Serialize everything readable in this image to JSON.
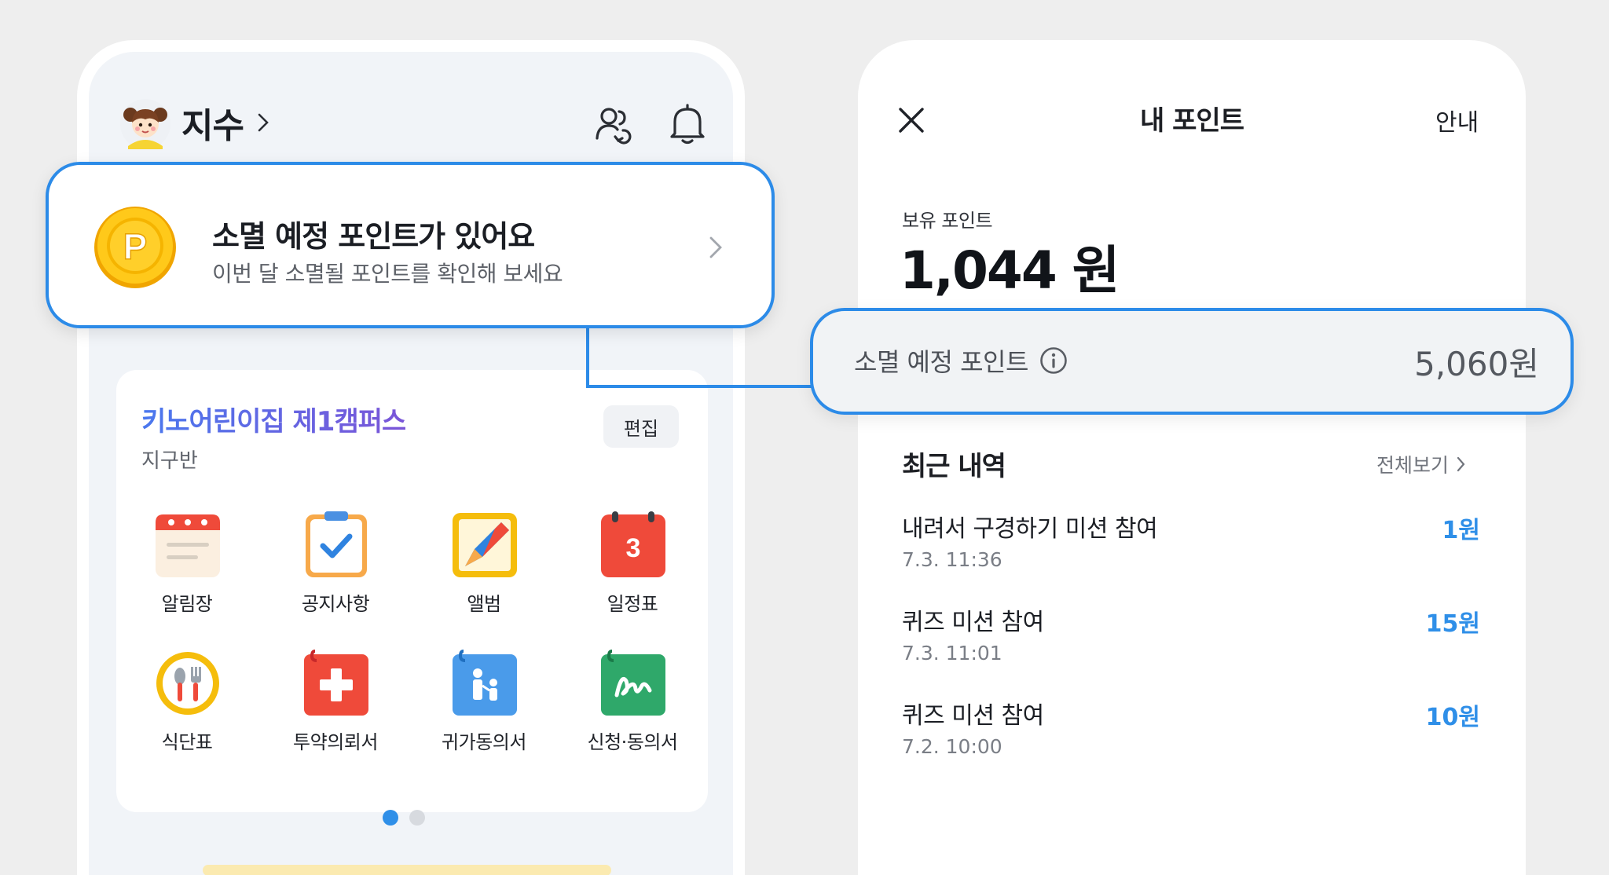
{
  "left_app": {
    "user_name": "지수",
    "campus_card": {
      "campus_name": "키노어린이집 제1캠퍼스",
      "class_name": "지구반",
      "edit_label": "편집",
      "menu": [
        {
          "label": "알림장",
          "icon": "notebook-icon"
        },
        {
          "label": "공지사항",
          "icon": "checklist-icon"
        },
        {
          "label": "앨범",
          "icon": "album-icon"
        },
        {
          "label": "일정표",
          "icon": "calendar-icon",
          "badge": "3"
        },
        {
          "label": "식단표",
          "icon": "meal-icon"
        },
        {
          "label": "투약의뢰서",
          "icon": "medicine-icon"
        },
        {
          "label": "귀가동의서",
          "icon": "go-home-icon"
        },
        {
          "label": "신청·동의서",
          "icon": "signature-icon"
        }
      ],
      "page_count": 2,
      "active_page": 1
    }
  },
  "banner": {
    "title": "소멸 예정 포인트가 있어요",
    "subtitle": "이번 달 소멸될 포인트를 확인해 보세요",
    "coin_letter": "P"
  },
  "right_app": {
    "title": "내 포인트",
    "guide_label": "안내",
    "balance_label": "보유 포인트",
    "balance_value": "1,044 원",
    "expiring": {
      "label": "소멸 예정 포인트",
      "value": "5,060원"
    },
    "recent": {
      "title": "최근 내역",
      "view_all": "전체보기",
      "items": [
        {
          "title": "내려서 구경하기 미션 참여",
          "time": "7.3. 11:36",
          "amount": "1원"
        },
        {
          "title": "퀴즈 미션 참여",
          "time": "7.3. 11:01",
          "amount": "15원"
        },
        {
          "title": "퀴즈 미션 참여",
          "time": "7.2. 10:00",
          "amount": "10원"
        }
      ]
    }
  },
  "colors": {
    "accent_blue": "#2c8be8",
    "amount_blue": "#2f8fe8",
    "coin_gold": "#f5bd0c",
    "calendar_red": "#ef4a3a"
  }
}
